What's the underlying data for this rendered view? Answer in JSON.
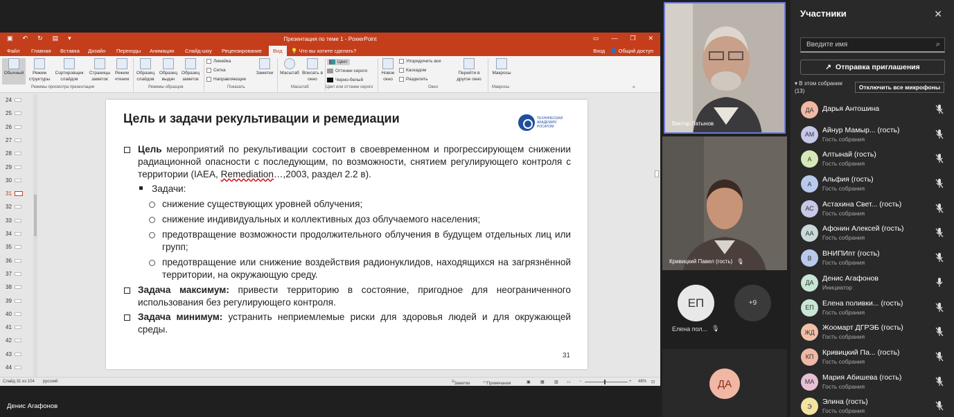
{
  "powerpoint": {
    "title": "Презентация по теме 1 - PowerPoint",
    "tabs": [
      "Файл",
      "Главная",
      "Вставка",
      "Дизайн",
      "Переходы",
      "Анимация",
      "Слайд-шоу",
      "Рецензирование",
      "Вид"
    ],
    "active_tab": "Вид",
    "tell_me": "Что вы хотите сделать?",
    "signin": "Вход",
    "share": "Общий доступ",
    "ribbon": {
      "normal": "Обычный",
      "structure": "Режим структуры",
      "slide_sorter": "Сортировщик слайдов",
      "notes_page": "Страницы заметок",
      "reading": "Режим чтения",
      "group_views": "Режимы просмотра презентации",
      "slide_master": "Образец слайдов",
      "handout_master": "Образец выдач",
      "notes_master": "Образец заметок",
      "group_masters": "Режимы образцов",
      "ruler": "Линейка",
      "grid": "Сетка",
      "guides": "Направляющие",
      "group_show": "Показать",
      "notes": "Заметки",
      "zoom": "Масштаб",
      "fit": "Вписать в окно",
      "group_zoom": "Масштаб",
      "color": "Цвет",
      "grayscale": "Оттенки серого",
      "bw": "Черно-белый",
      "group_color": "Цвет или оттенки серого",
      "new_window": "Новое окно",
      "arrange_all": "Упорядочить все",
      "cascade": "Каскадом",
      "split": "Разделить",
      "switch_window": "Перейти в другое окно",
      "group_window": "Окно",
      "macros": "Макросы",
      "group_macros": "Макросы"
    },
    "thumbnails": [
      "24",
      "25",
      "26",
      "27",
      "28",
      "29",
      "30",
      "31",
      "32",
      "33",
      "34",
      "35",
      "36",
      "37",
      "38",
      "39",
      "40",
      "41",
      "42",
      "43",
      "44"
    ],
    "active_thumbnail": "31",
    "status": {
      "slide": "Слайд 31 из 104",
      "lang": "русский",
      "notes": "Заметки",
      "comments": "Примечания",
      "zoom": "48%"
    }
  },
  "slide": {
    "title": "Цель и задачи рекультивации и ремедиации",
    "logo_text": [
      "ТЕХНИЧЕСКАЯ",
      "АКАДЕМИЯ",
      "РОСАТОМ"
    ],
    "p1_bold": "Цель",
    "p1_a": " мероприятий по рекультивации состоит в своевременном и прогрессирующем снижении радиационной опасности  с последующим, по возможности,  снятием регулирующего контроля с территории (IAEA, ",
    "p1_u": "Remediation",
    "p1_b": "…,2003, раздел 2.2 в).",
    "tasks": "Задачи:",
    "t1": "снижение существующих уровней облучения;",
    "t2": "снижение индивидуальных и коллективных доз облучаемого населения;",
    "t3": "предотвращение возможности продолжительного облучения в будущем отдельных лиц или групп;",
    "t4": "предотвращение или снижение воздействия радионуклидов, находящихся на загрязнённой территории, на окружающую среду.",
    "max_bold": "Задача максимум:",
    "max_text": " привести территорию в состояние, пригодное для неограниченного использования без регулирующего контроля.",
    "min_bold": "Задача минимум:",
    "min_text": " устранить неприемлемые риски для здоровья людей и для окружающей среды.",
    "page": "31"
  },
  "presenter_caption": "Денис Агафонов",
  "video": {
    "tile1_name": "Виктор Латынов",
    "tile2_name": "Кривицкий Павел (гость)",
    "ep_initials": "ЕП",
    "ep_name": "Елена пол...",
    "more": "+9",
    "da_initials": "ДА"
  },
  "panel": {
    "title": "Участники",
    "search_placeholder": "Введите имя",
    "invite": "Отправка приглашения",
    "in_meeting": "В этом собрании",
    "count": "(13)",
    "mute_all": "Отключить все микрофоны",
    "participants": [
      {
        "initials": "ДА",
        "name": "Дарья Антошина",
        "role": "",
        "color": "#f1b7a5",
        "mic": "muted"
      },
      {
        "initials": "АМ",
        "name": "Айнур Мамыр... (гость)",
        "role": "Гость собрания",
        "color": "#c7c7e8",
        "mic": "muted"
      },
      {
        "initials": "А",
        "name": "Алтынай (гость)",
        "role": "Гость собрания",
        "color": "#d6e8b8",
        "mic": "muted"
      },
      {
        "initials": "А",
        "name": "Альфия (гость)",
        "role": "Гость собрания",
        "color": "#b9c9ec",
        "mic": "muted"
      },
      {
        "initials": "АС",
        "name": "Астахина Свет... (гость)",
        "role": "Гость собрания",
        "color": "#c7c7e8",
        "mic": "muted"
      },
      {
        "initials": "АА",
        "name": "Афонин Алексей (гость)",
        "role": "Гость собрания",
        "color": "#c9d8d8",
        "mic": "muted"
      },
      {
        "initials": "В",
        "name": "ВНИПИпт (гость)",
        "role": "Гость собрания",
        "color": "#b9c9ec",
        "mic": "muted"
      },
      {
        "initials": "ДА",
        "name": "Денис Агафонов",
        "role": "Инициатор",
        "color": "#c9e6d4",
        "mic": "on"
      },
      {
        "initials": "ЕП",
        "name": "Елена поливки... (гость)",
        "role": "Гость собрания",
        "color": "#c9e6d4",
        "mic": "muted"
      },
      {
        "initials": "ЖД",
        "name": "Жоомарт ДГРЭБ (гость)",
        "role": "Гость собрания",
        "color": "#f2c0a8",
        "mic": "muted"
      },
      {
        "initials": "КП",
        "name": "Кривицкий Па... (гость)",
        "role": "Гость собрания",
        "color": "#f1b7a5",
        "mic": "muted"
      },
      {
        "initials": "МА",
        "name": "Мария Абишева (гость)",
        "role": "Гость собрания",
        "color": "#e8bfd4",
        "mic": "muted"
      },
      {
        "initials": "Э",
        "name": "Элина (гость)",
        "role": "Гость собрания",
        "color": "#f3e3a0",
        "mic": "muted"
      }
    ]
  }
}
